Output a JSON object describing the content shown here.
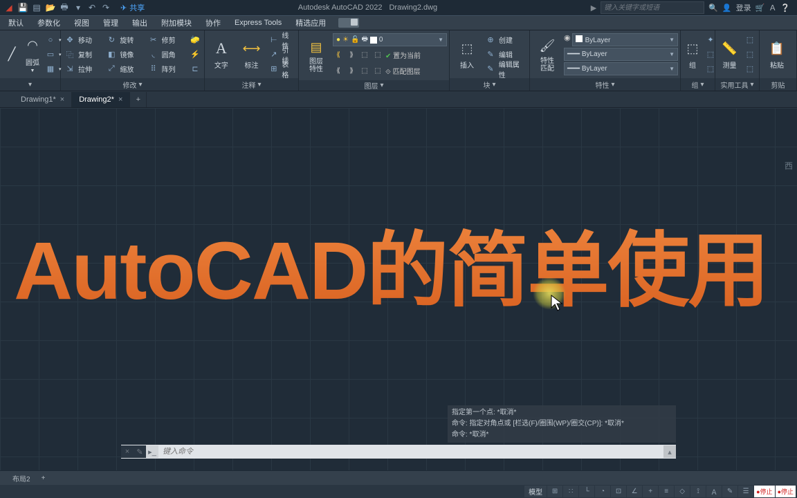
{
  "titlebar": {
    "app": "Autodesk AutoCAD 2022",
    "file": "Drawing2.dwg",
    "share": "共享",
    "search_placeholder": "键入关键字或短语",
    "login": "登录"
  },
  "menu": {
    "items": [
      "默认",
      "参数化",
      "视图",
      "管理",
      "输出",
      "附加模块",
      "协作",
      "Express Tools",
      "精选应用"
    ]
  },
  "ribbon": {
    "draw": {
      "arc": "圆弧"
    },
    "modify": {
      "title": "修改",
      "move": "移动",
      "rotate": "旋转",
      "trim": "修剪",
      "copy": "复制",
      "mirror": "镜像",
      "fillet": "圆角",
      "stretch": "拉伸",
      "scale": "缩放",
      "array": "阵列"
    },
    "annotate": {
      "title": "注释",
      "text": "文字",
      "dim": "标注",
      "linear": "线性",
      "leader": "引线",
      "table": "表格"
    },
    "layer": {
      "title": "图层",
      "props": "图层\n特性",
      "current": "0",
      "setcur": "置为当前",
      "match": "匹配图层"
    },
    "block": {
      "title": "块",
      "insert": "插入",
      "create": "创建",
      "edit": "编辑",
      "attr": "编辑属性"
    },
    "props": {
      "title": "特性",
      "match": "特性\n匹配",
      "bylayer": "ByLayer"
    },
    "group": {
      "title": "组",
      "group": "组"
    },
    "util": {
      "title": "实用工具",
      "measure": "测量"
    },
    "clip": {
      "title": "剪贴",
      "paste": "粘贴"
    }
  },
  "tabs": {
    "t1": "Drawing1*",
    "t2": "Drawing2*"
  },
  "canvas": {
    "bigtext": "AutoCAD的简单使用",
    "nav": "西"
  },
  "cmd": {
    "h1": "指定第一个点: *取消*",
    "h2": "命令: 指定对角点或 [栏选(F)/圈围(WP)/圈交(CP)]: *取消*",
    "h3": "命令: *取消*",
    "placeholder": "键入命令"
  },
  "layout": {
    "tab": "布局2"
  },
  "status": {
    "model": "模型",
    "stop": "●停止"
  }
}
